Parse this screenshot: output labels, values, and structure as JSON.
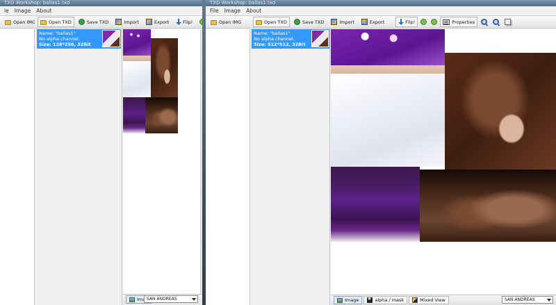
{
  "left_window": {
    "title": "TXD Workshop: ballas1.txd",
    "menu": [
      "le",
      "Image",
      "About"
    ],
    "toolbar_left": "Open IMG",
    "toolbar": {
      "open_txd": "Open TXD",
      "save_txd": "Save TXD",
      "import": "Import",
      "export": "Export",
      "flip": "Flip!"
    },
    "texture_item": {
      "name_line": "Name: \"ballas1\"",
      "alpha_line": "No alpha channel.",
      "size_line": "Size: 128*256, 32Bit"
    },
    "bottom_tab_image": "Imag",
    "game_select": "SAN ANDREAS"
  },
  "right_window": {
    "title": "TXD Workshop: ballas1.txd",
    "menu": [
      "File",
      "Image",
      "About"
    ],
    "toolbar_left": "Open IMG",
    "toolbar": {
      "open_txd": "Open TXD",
      "save_txd": "Save TXD",
      "import": "Import",
      "export": "Export",
      "flip": "Flip!",
      "properties": "Properties"
    },
    "texture_item": {
      "name_line": "Name: \"ballas1\"",
      "alpha_line": "No alpha channel.",
      "size_line": "Size: 512*512, 32Bit"
    },
    "bottom_tabs": [
      "Image",
      "alpha / mask",
      "Mixed View"
    ],
    "game_select": "SAN ANDREAS"
  },
  "icons": {
    "folder": "folder-icon",
    "save": "save-icon",
    "import": "import-icon",
    "export": "export-icon",
    "flip": "flip-arrow-icon",
    "rotate_left": "rotate-left-icon",
    "rotate_right": "rotate-right-icon",
    "properties": "properties-icon",
    "zoom_in": "zoom-in-icon",
    "zoom_out": "zoom-out-icon",
    "copy": "copy-icon"
  },
  "colors": {
    "selection": "#3399ff",
    "title_bar": "#4f6b86",
    "bandana_purple": "#6a1ea0"
  }
}
